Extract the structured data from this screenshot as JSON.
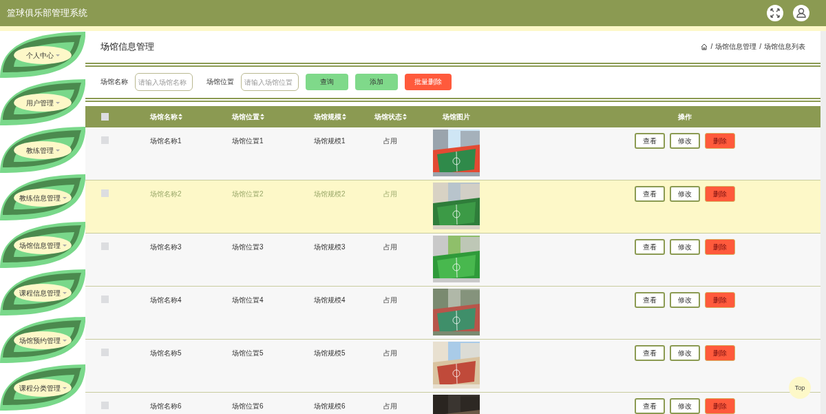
{
  "header": {
    "title": "篮球俱乐部管理系统"
  },
  "sidebar": {
    "items": [
      {
        "label": "个人中心"
      },
      {
        "label": "用户管理"
      },
      {
        "label": "教练管理"
      },
      {
        "label": "教练信息管理"
      },
      {
        "label": "场馆信息管理"
      },
      {
        "label": "课程信息管理"
      },
      {
        "label": "场馆预约管理"
      },
      {
        "label": "课程分类管理"
      }
    ]
  },
  "page": {
    "title": "场馆信息管理",
    "breadcrumb": {
      "separator": "/",
      "items": [
        "场馆信息管理",
        "场馆信息列表"
      ]
    }
  },
  "search": {
    "fields": [
      {
        "label": "场馆名称",
        "placeholder": "请输入场馆名称"
      },
      {
        "label": "场馆位置",
        "placeholder": "请输入场馆位置"
      }
    ],
    "buttons": [
      {
        "label": "查询",
        "kind": "primary"
      },
      {
        "label": "添加",
        "kind": "primary"
      },
      {
        "label": "批量删除",
        "kind": "danger"
      }
    ]
  },
  "table": {
    "select_all": {
      "checked": false
    },
    "columns": [
      {
        "label": "场馆名称",
        "sortable": true
      },
      {
        "label": "场馆位置",
        "sortable": true
      },
      {
        "label": "场馆规模",
        "sortable": true
      },
      {
        "label": "场馆状态",
        "sortable": true
      },
      {
        "label": "场馆图片",
        "sortable": false
      },
      {
        "label": "操作",
        "sortable": false
      }
    ],
    "rows": [
      {
        "checked": false,
        "hovered": false,
        "name": "场馆名称1",
        "location": "场馆位置1",
        "scale": "场馆规模1",
        "status": "占用",
        "actions": [
          {
            "label": "查看",
            "kind": "outline"
          },
          {
            "label": "修改",
            "kind": "outline"
          },
          {
            "label": "删除",
            "kind": "danger"
          }
        ]
      },
      {
        "checked": false,
        "hovered": true,
        "name": "场馆名称2",
        "location": "场馆位置2",
        "scale": "场馆规模2",
        "status": "占用",
        "actions": [
          {
            "label": "查看",
            "kind": "outline"
          },
          {
            "label": "修改",
            "kind": "outline"
          },
          {
            "label": "删除",
            "kind": "danger"
          }
        ]
      },
      {
        "checked": false,
        "hovered": false,
        "name": "场馆名称3",
        "location": "场馆位置3",
        "scale": "场馆规模3",
        "status": "占用",
        "actions": [
          {
            "label": "查看",
            "kind": "outline"
          },
          {
            "label": "修改",
            "kind": "outline"
          },
          {
            "label": "删除",
            "kind": "danger"
          }
        ]
      },
      {
        "checked": false,
        "hovered": false,
        "name": "场馆名称4",
        "location": "场馆位置4",
        "scale": "场馆规模4",
        "status": "占用",
        "actions": [
          {
            "label": "查看",
            "kind": "outline"
          },
          {
            "label": "修改",
            "kind": "outline"
          },
          {
            "label": "删除",
            "kind": "danger"
          }
        ]
      },
      {
        "checked": false,
        "hovered": false,
        "name": "场馆名称5",
        "location": "场馆位置5",
        "scale": "场馆规模5",
        "status": "占用",
        "actions": [
          {
            "label": "查看",
            "kind": "outline"
          },
          {
            "label": "修改",
            "kind": "outline"
          },
          {
            "label": "删除",
            "kind": "danger"
          }
        ]
      },
      {
        "checked": false,
        "hovered": false,
        "name": "场馆名称6",
        "location": "场馆位置6",
        "scale": "场馆规模6",
        "status": "占用",
        "actions": [
          {
            "label": "查看",
            "kind": "outline"
          },
          {
            "label": "修改",
            "kind": "outline"
          },
          {
            "label": "删除",
            "kind": "danger"
          }
        ]
      }
    ]
  },
  "back_to_top": {
    "label": "Top"
  }
}
